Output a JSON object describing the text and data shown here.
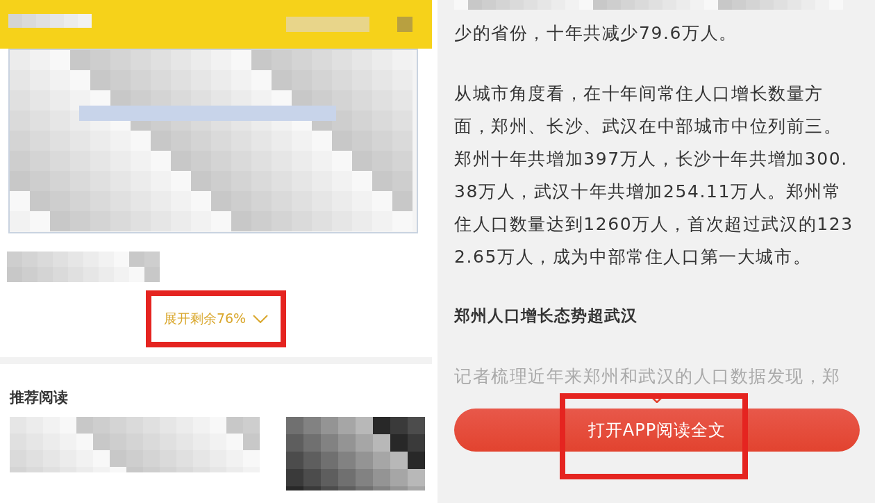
{
  "left_panel": {
    "expand_link": {
      "label": "展开剩余76%",
      "highlighted": true
    },
    "recommended_title": "推荐阅读"
  },
  "right_panel": {
    "paragraphs": [
      "少的省份，十年共减少79.6万人。",
      "从城市角度看，在十年间常住人口增长数量方面，郑州、长沙、武汉在中部城市中位列前三。郑州十年共增加397万人，长沙十年共增加300.38万人，武汉十年共增加254.11万人。郑州常住人口数量达到1260万人，首次超过武汉的1232.65万人，成为中部常住人口第一大城市。"
    ],
    "heading": "郑州人口增长态势超武汉",
    "faded_paragraph": "记者梳理近年来郑州和武汉的人口数据发现，郑",
    "open_app_button": {
      "label": "打开APP阅读全文",
      "highlighted": true
    }
  }
}
